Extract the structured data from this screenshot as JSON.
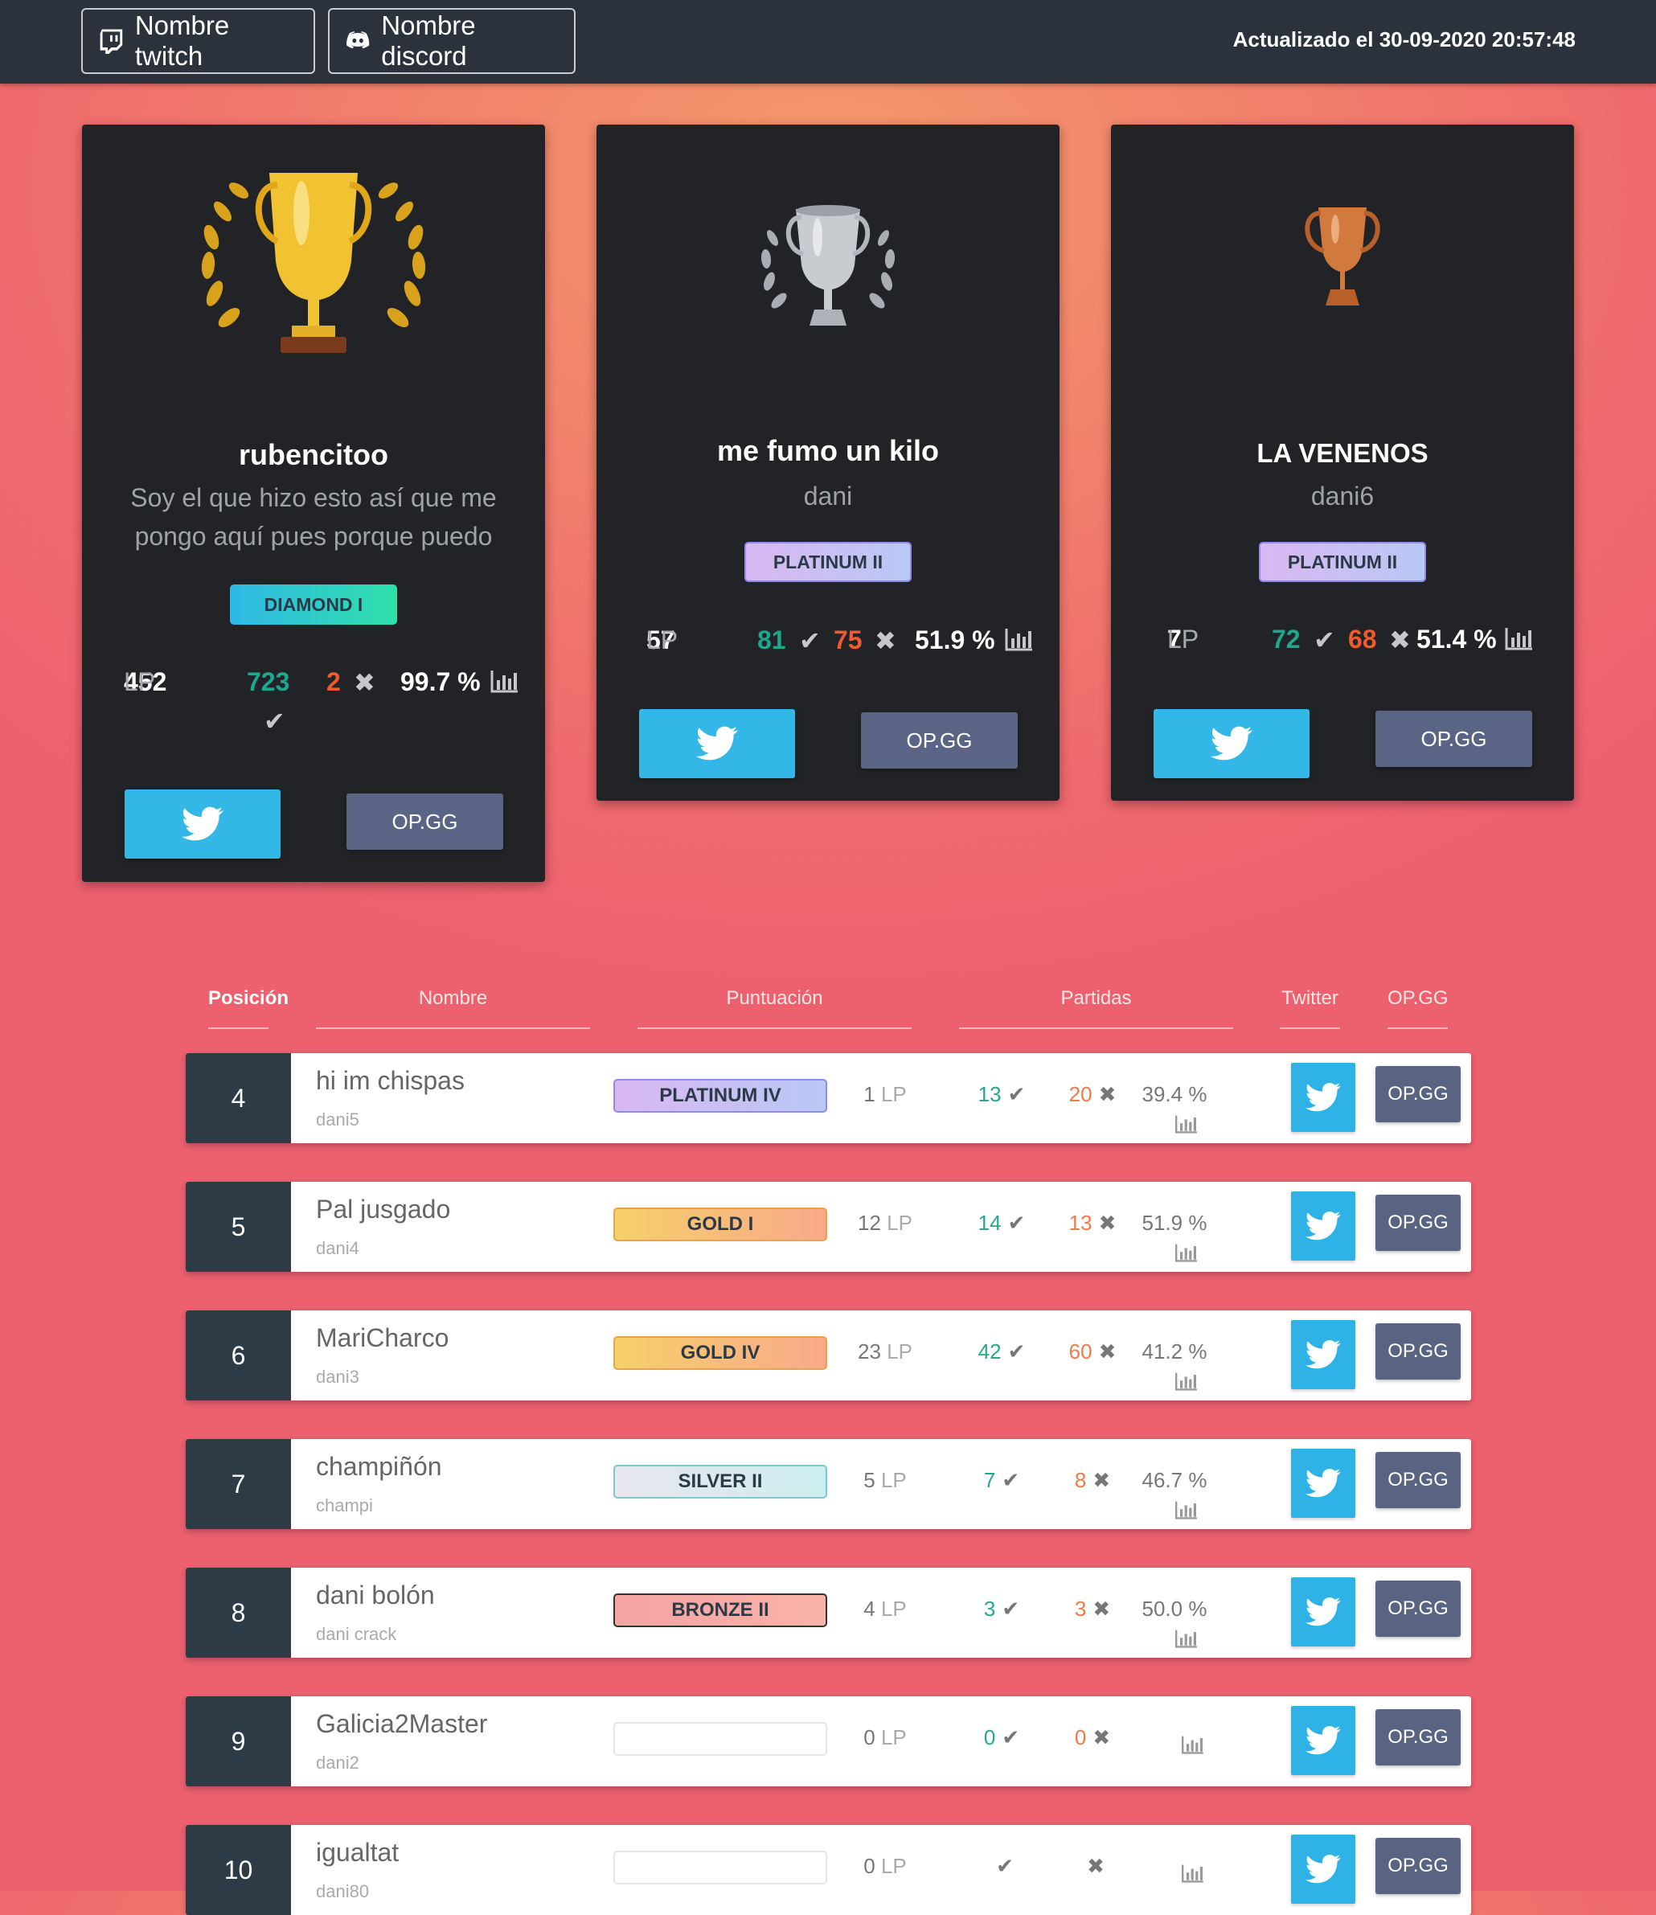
{
  "header": {
    "twitch_label": "Nombre twitch",
    "discord_label": "Nombre discord",
    "updated": "Actualizado el 30-09-2020 20:57:48"
  },
  "podium": [
    {
      "name": "rubencitoo",
      "sub": "Soy el que hizo esto así que me pongo aquí pues porque puedo",
      "tier": "DIAMOND I",
      "lp": "452",
      "lp_unit": "LP",
      "wins": "723",
      "losses": "2",
      "pct": "99.7 %",
      "trophy": "gold-trophy-icon",
      "opgg": "OP.GG"
    },
    {
      "name": "me fumo un kilo",
      "sub": "dani",
      "tier": "PLATINUM II",
      "lp": "57",
      "lp_unit": "LP",
      "wins": "81",
      "losses": "75",
      "pct": "51.9 %",
      "trophy": "silver-trophy-icon",
      "opgg": "OP.GG"
    },
    {
      "name": "LA VENENOS",
      "sub": "dani6",
      "tier": "PLATINUM II",
      "lp": "7",
      "lp_unit": "LP",
      "wins": "72",
      "losses": "68",
      "pct": "51.4 %",
      "trophy": "bronze-trophy-icon",
      "opgg": "OP.GG"
    }
  ],
  "table": {
    "headers": [
      "Posición",
      "Nombre",
      "Puntuación",
      "Partidas",
      "Twitter",
      "OP.GG"
    ],
    "rows": [
      {
        "pos": "4",
        "name": "hi im chispas",
        "sub": "dani5",
        "tier": "PLATINUM IV",
        "lp": "1",
        "lp_unit": "LP",
        "wins": "13",
        "losses": "20",
        "pct": "39.4 %",
        "opgg": "OP.GG"
      },
      {
        "pos": "5",
        "name": "Pal jusgado",
        "sub": "dani4",
        "tier": "GOLD I",
        "lp": "12",
        "lp_unit": "LP",
        "wins": "14",
        "losses": "13",
        "pct": "51.9 %",
        "opgg": "OP.GG"
      },
      {
        "pos": "6",
        "name": "MariCharco",
        "sub": "dani3",
        "tier": "GOLD IV",
        "lp": "23",
        "lp_unit": "LP",
        "wins": "42",
        "losses": "60",
        "pct": "41.2 %",
        "opgg": "OP.GG"
      },
      {
        "pos": "7",
        "name": "champiñón",
        "sub": "champi",
        "tier": "SILVER II",
        "lp": "5",
        "lp_unit": "LP",
        "wins": "7",
        "losses": "8",
        "pct": "46.7 %",
        "opgg": "OP.GG"
      },
      {
        "pos": "8",
        "name": "dani bolón",
        "sub": "dani crack",
        "tier": "BRONZE II",
        "lp": "4",
        "lp_unit": "LP",
        "wins": "3",
        "losses": "3",
        "pct": "50.0 %",
        "opgg": "OP.GG"
      },
      {
        "pos": "9",
        "name": "Galicia2Master",
        "sub": "dani2",
        "tier": "",
        "lp": "0",
        "lp_unit": "LP",
        "wins": "0",
        "losses": "0",
        "pct": "",
        "opgg": "OP.GG"
      },
      {
        "pos": "10",
        "name": "igualtat",
        "sub": "dani80",
        "tier": "",
        "lp": "0",
        "lp_unit": "LP",
        "wins": "",
        "losses": "",
        "pct": "",
        "opgg": "OP.GG"
      }
    ]
  },
  "colors": {
    "diamond": "#2fb8e8",
    "platinum": "#cbb7f3",
    "gold": "#f6c46a",
    "silver": "#d6ecef",
    "bronze": "#f3a0a0",
    "win": "#1ea68e",
    "loss": "#ee5b2d",
    "twitter": "#33b7e6",
    "opgg": "#5a6484"
  },
  "icons": {
    "check": "check-icon",
    "cross": "cross-icon",
    "chart": "bar-chart-icon",
    "twitter": "twitter-bird-icon"
  }
}
